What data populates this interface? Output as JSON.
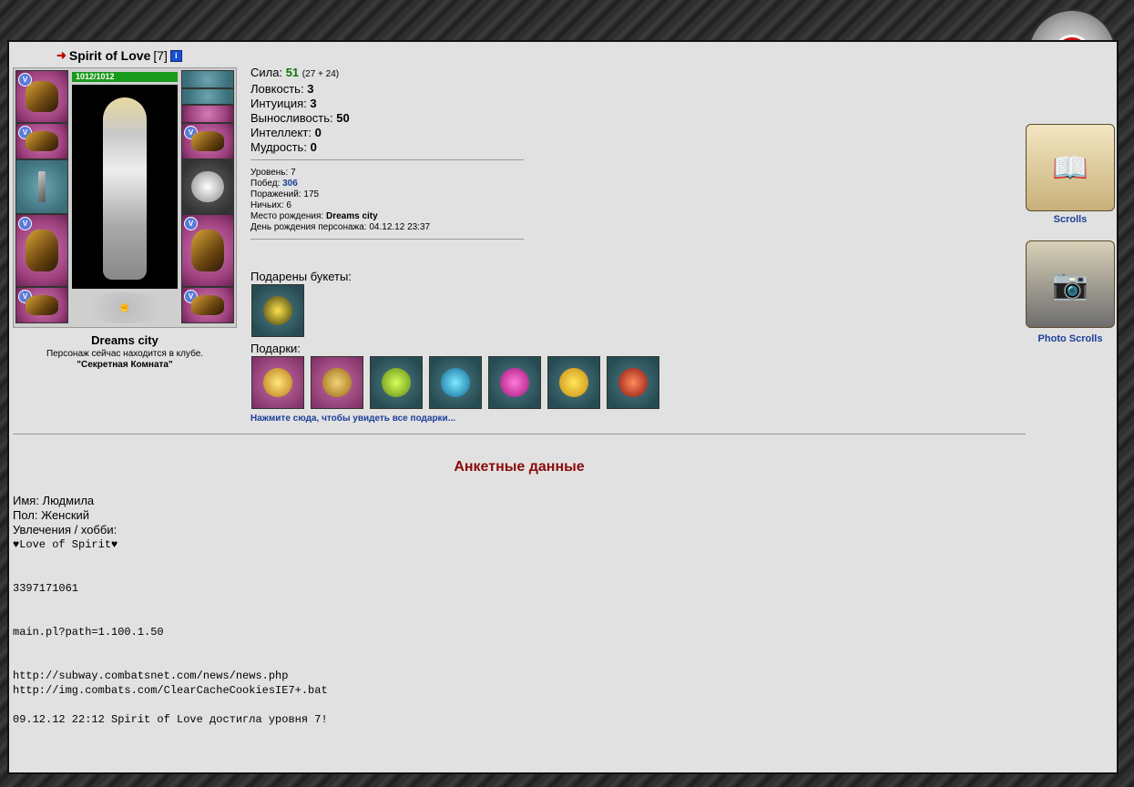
{
  "character": {
    "name": "Spirit of Love",
    "level_tag": "[7]",
    "hp": "1012/1012",
    "city": "Dreams city",
    "location_text": "Персонаж сейчас находится в клубе.",
    "location_room": "\"Секретная Комната\""
  },
  "stats": {
    "strength_label": "Сила:",
    "strength_value": "51",
    "strength_detail": "(27 + 24)",
    "agility_label": "Ловкость:",
    "agility_value": "3",
    "intuition_label": "Интуиция:",
    "intuition_value": "3",
    "endurance_label": "Выносливость:",
    "endurance_value": "50",
    "intellect_label": "Интеллект:",
    "intellect_value": "0",
    "wisdom_label": "Мудрость:",
    "wisdom_value": "0"
  },
  "info": {
    "level_label": "Уровень:",
    "level_value": "7",
    "wins_label": "Побед:",
    "wins_value": "306",
    "losses_label": "Поражений:",
    "losses_value": "175",
    "draws_label": "Ничьих:",
    "draws_value": "6",
    "birthplace_label": "Место рождения:",
    "birthplace_value": "Dreams city",
    "birthday_label": "День рождения персонажа:",
    "birthday_value": "04.12.12 23:37"
  },
  "bouquets_label": "Подарены букеты:",
  "gifts_label": "Подарки:",
  "all_gifts_link": "Нажмите сюда, чтобы увидеть все подарки...",
  "profile": {
    "title": "Анкетные данные",
    "name_line": "Имя: Людмила",
    "gender_line": "Пол: Женский",
    "hobby_line": "Увлечения / хобби:",
    "hobby_text": "♥Love of Spirit♥",
    "line_number": "3397171061",
    "line_path": "main.pl?path=1.100.1.50",
    "line_url1": "http://subway.combatsnet.com/news/news.php",
    "line_url2": "http://img.combats.com/ClearCacheCookiesIE7+.bat",
    "line_event": "09.12.12 22:12 Spirit of Love достигла уровня 7!"
  },
  "right": {
    "scrolls_label": "Scrolls",
    "photo_scrolls_label": "Photo Scrolls"
  },
  "colors": {
    "accent_red": "#8a0b0b",
    "link_blue": "#1a3f9a",
    "stat_green": "#0b7a0b",
    "panel_bg": "#e2e1e1"
  }
}
